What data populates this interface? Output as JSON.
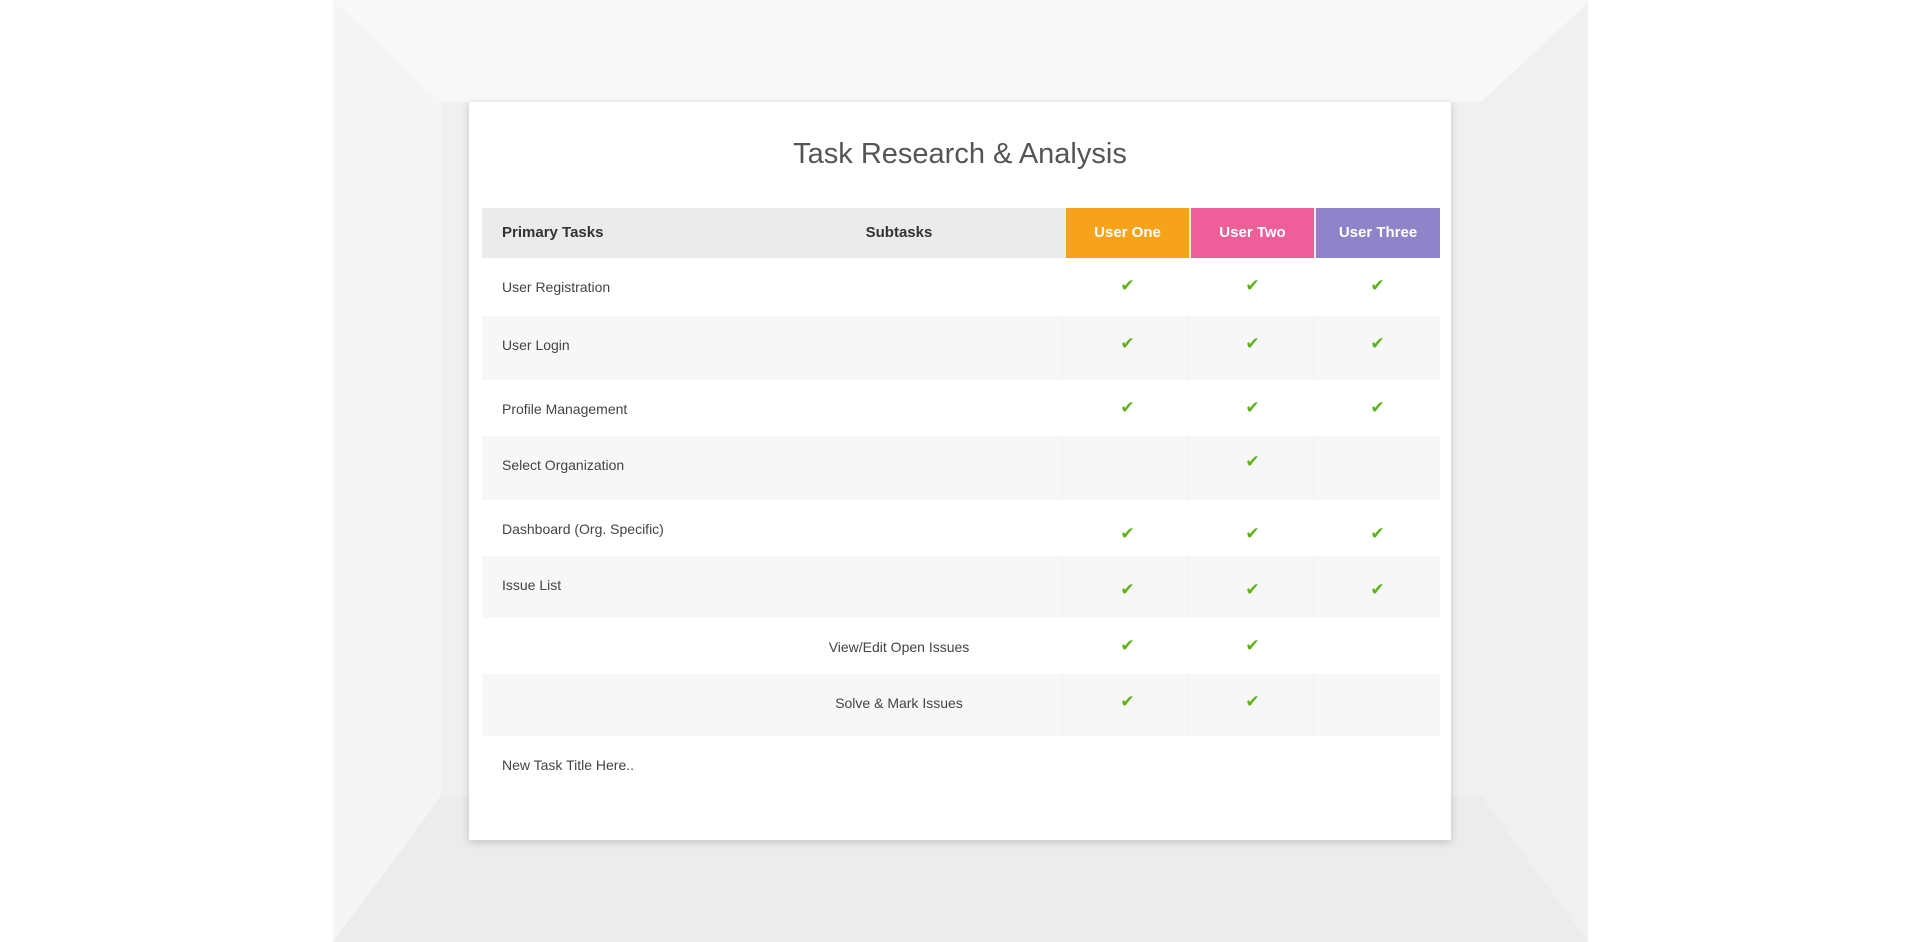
{
  "title": "Task Research & Analysis",
  "columns": {
    "primary": "Primary Tasks",
    "subtasks": "Subtasks",
    "users": [
      "User One",
      "User Two",
      "User Three"
    ]
  },
  "colors": {
    "user_one": "#f7a21b",
    "user_two": "#ee5f9a",
    "user_three": "#8f84c9",
    "check": "#5bb318"
  },
  "check_icon": "check-icon",
  "rows": [
    {
      "primary": "User Registration",
      "subtask": "",
      "checks": [
        true,
        true,
        true
      ]
    },
    {
      "primary": "User Login",
      "subtask": "",
      "checks": [
        true,
        true,
        true
      ]
    },
    {
      "primary": "Profile Management",
      "subtask": "",
      "checks": [
        true,
        true,
        true
      ]
    },
    {
      "primary": "Select Organization",
      "subtask": "",
      "checks": [
        false,
        true,
        false
      ]
    },
    {
      "primary": "Dashboard (Org. Specific)",
      "subtask": "",
      "checks": [
        true,
        true,
        true
      ]
    },
    {
      "primary": "Issue List",
      "subtask": "",
      "checks": [
        true,
        true,
        true
      ]
    },
    {
      "primary": "",
      "subtask": "View/Edit Open Issues",
      "checks": [
        true,
        true,
        false
      ]
    },
    {
      "primary": "",
      "subtask": "Solve & Mark Issues",
      "checks": [
        true,
        true,
        false
      ]
    },
    {
      "primary": "New Task Title Here..",
      "subtask": "",
      "checks": [
        false,
        false,
        false
      ]
    }
  ]
}
